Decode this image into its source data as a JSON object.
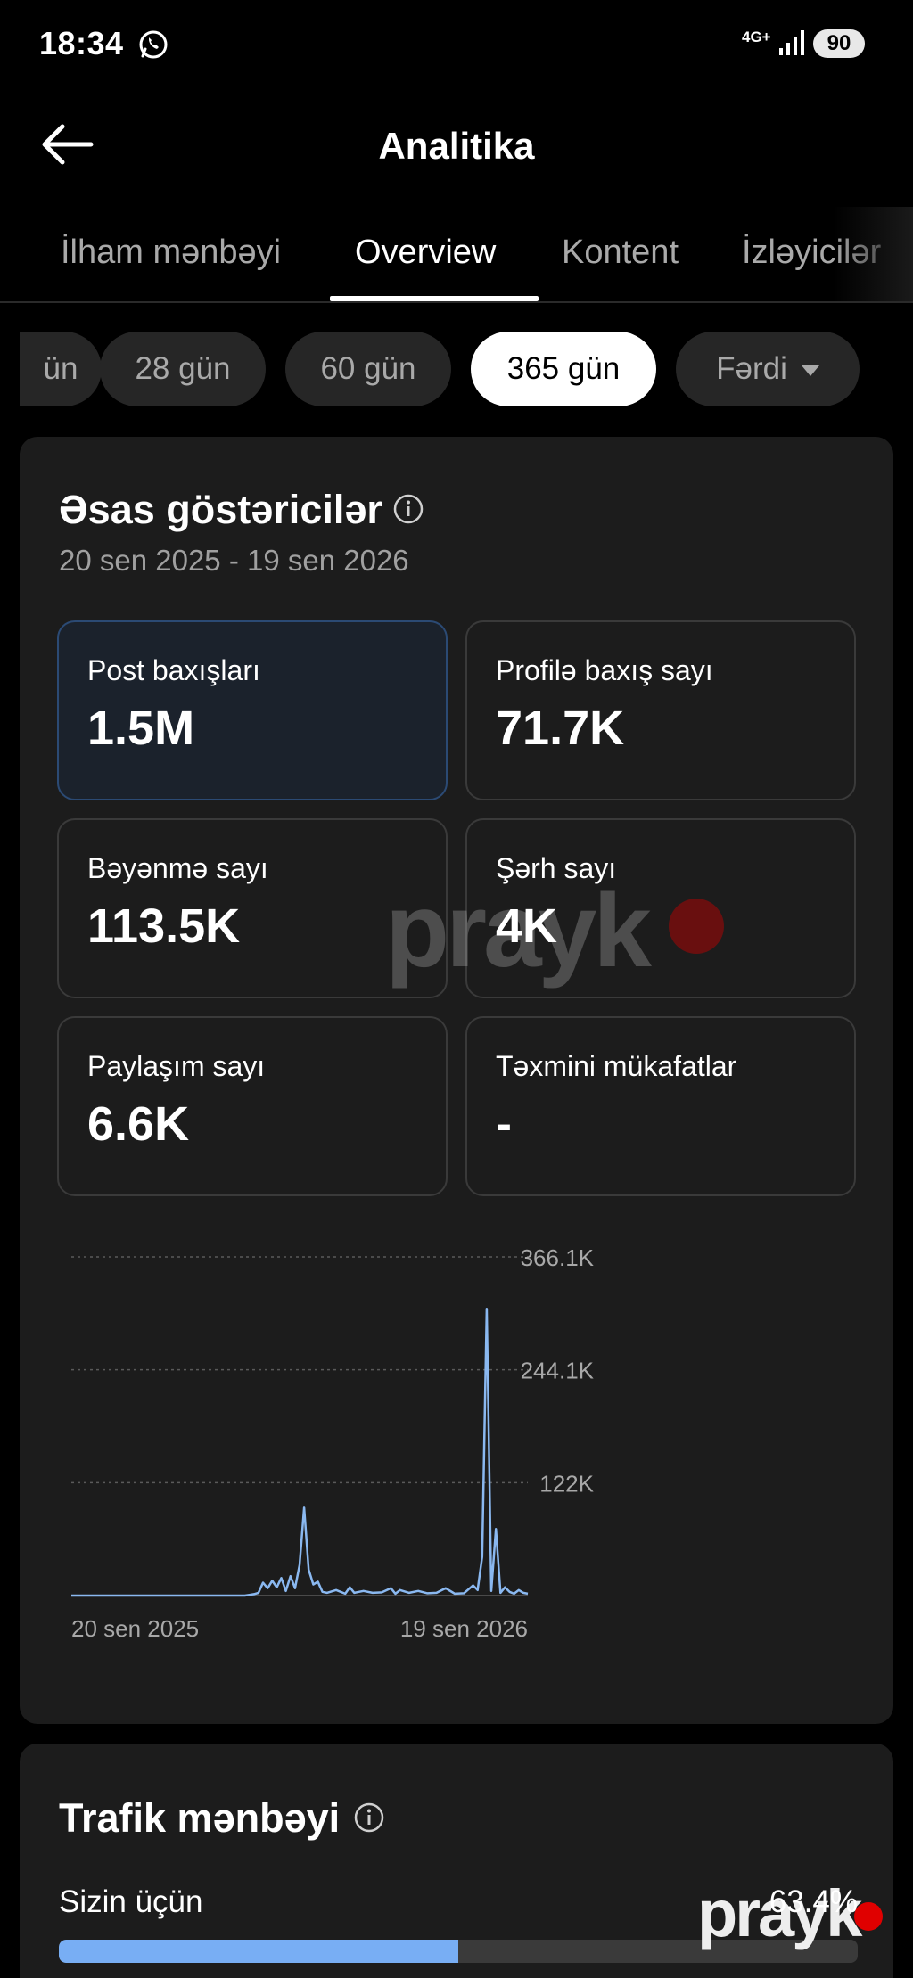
{
  "status_bar": {
    "time": "18:34",
    "network": "4G+",
    "battery": "90",
    "icons": [
      "whatsapp-icon",
      "signal-icon",
      "battery-icon"
    ]
  },
  "header": {
    "title": "Analitika"
  },
  "tabs": [
    {
      "label": "İlham mənbəyi",
      "active": false
    },
    {
      "label": "Overview",
      "active": true
    },
    {
      "label": "Kontent",
      "active": false
    },
    {
      "label": "İzləyicilər",
      "active": false
    }
  ],
  "periods": [
    {
      "label": "ün",
      "active": false
    },
    {
      "label": "28 gün",
      "active": false
    },
    {
      "label": "60 gün",
      "active": false
    },
    {
      "label": "365 gün",
      "active": true
    },
    {
      "label": "Fərdi",
      "active": false
    }
  ],
  "overview": {
    "title": "Əsas göstəricilər",
    "date_range": "20 sen 2025 - 19 sen 2026",
    "metrics": [
      {
        "label": "Post baxışları",
        "value": "1.5M",
        "selected": true
      },
      {
        "label": "Profilə baxış sayı",
        "value": "71.7K",
        "selected": false
      },
      {
        "label": "Bəyənmə sayı",
        "value": "113.5K",
        "selected": false
      },
      {
        "label": "Şərh sayı",
        "value": "4K",
        "selected": false
      },
      {
        "label": "Paylaşım sayı",
        "value": "6.6K",
        "selected": false
      },
      {
        "label": "Təxmini mükafatlar",
        "value": "-",
        "selected": false
      }
    ]
  },
  "chart_data": {
    "type": "line",
    "grid": true,
    "ylim": [
      0,
      366100
    ],
    "y_tick_labels": [
      "366.1K",
      "244.1K",
      "122K"
    ],
    "y_tick_values": [
      366100,
      244100,
      122000
    ],
    "x_tick_labels": [
      "20 sen 2025",
      "19 sen 2026"
    ],
    "series": [
      {
        "color": "#8ab8f0",
        "x": [
          0,
          10,
          20,
          30,
          40,
          50,
          60,
          70,
          80,
          90,
          100,
          110,
          120,
          130,
          140,
          150,
          160,
          170,
          180,
          190,
          195,
          200,
          205,
          210,
          215,
          220,
          225,
          230,
          235,
          240,
          245,
          250,
          255,
          260,
          265,
          270,
          275,
          280,
          290,
          300,
          305,
          310,
          315,
          320,
          330,
          340,
          350,
          355,
          360,
          370,
          380,
          390,
          400,
          410,
          420,
          430,
          440,
          445,
          450,
          455,
          460,
          465,
          470,
          475,
          480,
          485,
          490,
          495,
          500
        ],
        "y": [
          0,
          0,
          0,
          0,
          0,
          0,
          0,
          0,
          0,
          0,
          0,
          0,
          0,
          0,
          0,
          0,
          0,
          0,
          0,
          0,
          800,
          1500,
          3000,
          14000,
          8000,
          16000,
          9000,
          19000,
          5000,
          21000,
          8000,
          33000,
          95000,
          28000,
          12000,
          15000,
          4000,
          3000,
          6000,
          2000,
          9000,
          3000,
          4000,
          5000,
          3000,
          3500,
          8000,
          2000,
          6000,
          3000,
          5000,
          2500,
          3000,
          8000,
          2000,
          2500,
          11000,
          6000,
          42000,
          310000,
          5000,
          72000,
          3000,
          9000,
          4000,
          2000,
          6000,
          3000,
          2000
        ]
      }
    ]
  },
  "traffic": {
    "title": "Trafik mənbəyi",
    "items": [
      {
        "label": "Sizin üçün",
        "value": "63.4%",
        "fraction": 0.5
      }
    ]
  },
  "watermark": {
    "text": "prayk"
  }
}
